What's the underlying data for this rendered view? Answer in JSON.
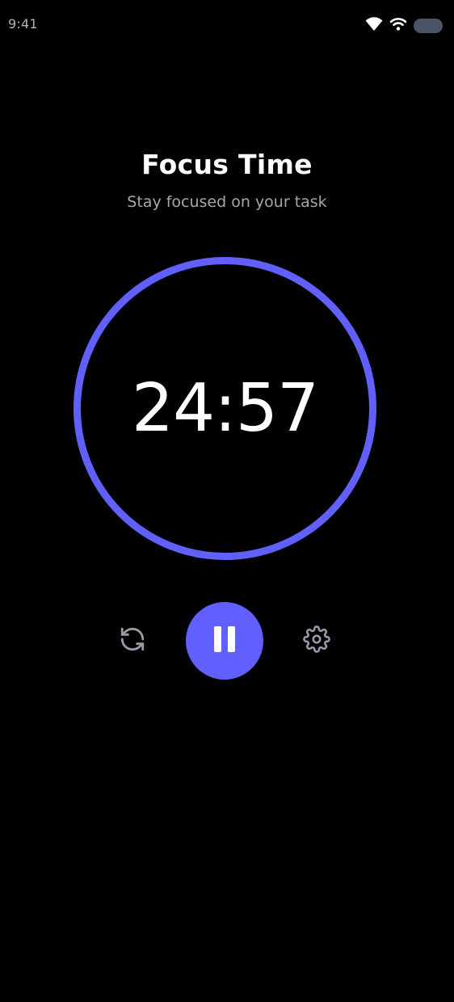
{
  "status_bar": {
    "time": "9:41",
    "icons": [
      "wifi-icon",
      "wifi-icon",
      "battery-icon"
    ]
  },
  "header": {
    "title": "Focus Time",
    "subtitle": "Stay focused on your task"
  },
  "timer": {
    "display": "24:57",
    "progress": 1.0
  },
  "controls": {
    "reset_icon": "refresh-icon",
    "pause_icon": "pause-icon",
    "settings_icon": "gear-icon"
  },
  "colors": {
    "background": "#000000",
    "accent": "#6160ff",
    "subtitle": "#a7a7a7",
    "icon_muted": "#9a9aa8",
    "battery": "#4a5568"
  }
}
